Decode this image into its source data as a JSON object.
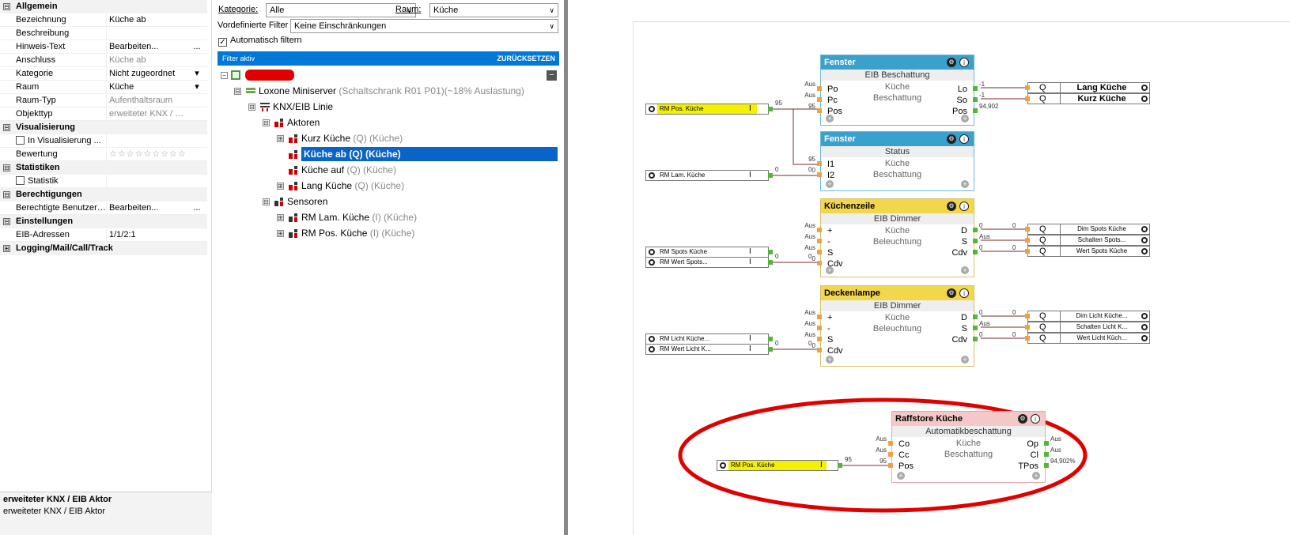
{
  "properties": {
    "rows": [
      {
        "type": "cat",
        "box": "⊟",
        "label": "Allgemein"
      },
      {
        "type": "prop",
        "name": "Bezeichnung",
        "value": "Küche ab"
      },
      {
        "type": "prop",
        "name": "Beschreibung",
        "value": ""
      },
      {
        "type": "prop",
        "name": "Hinweis-Text",
        "value": "Bearbeiten...",
        "button": "..."
      },
      {
        "type": "prop",
        "name": "Anschluss",
        "value": "Küche ab",
        "gray": true
      },
      {
        "type": "prop",
        "name": "Kategorie",
        "value": "Nicht zugeordnet",
        "button": "▾"
      },
      {
        "type": "prop",
        "name": "Raum",
        "value": "Küche",
        "button": "▾"
      },
      {
        "type": "prop",
        "name": "Raum-Typ",
        "value": "Aufenthaltsraum",
        "gray": true
      },
      {
        "type": "prop",
        "name": "Objekttyp",
        "value": "erweiteter KNX / EIB ...",
        "gray": true
      },
      {
        "type": "cat",
        "box": "⊟",
        "label": "Visualisierung"
      },
      {
        "type": "check",
        "name": "In Visualisierung ...",
        "value": ""
      },
      {
        "type": "prop",
        "name": "Bewertung",
        "value": "☆☆☆☆☆☆☆☆☆",
        "stars": true
      },
      {
        "type": "cat",
        "box": "⊟",
        "label": "Statistiken"
      },
      {
        "type": "check",
        "name": "Statistik",
        "value": ""
      },
      {
        "type": "cat",
        "box": "⊟",
        "label": "Berechtigungen"
      },
      {
        "type": "prop",
        "name": "Berechtigte Benutzer ...",
        "value": "Bearbeiten...",
        "button": "..."
      },
      {
        "type": "cat",
        "box": "⊟",
        "label": "Einstellungen"
      },
      {
        "type": "prop",
        "name": "EIB-Adressen",
        "value": "1/1/2:1"
      },
      {
        "type": "cat",
        "box": "⊞",
        "label": "Logging/Mail/Call/Track"
      }
    ],
    "desc_title": "erweiteter KNX / EIB Aktor",
    "desc_text": "erweiteter KNX / EIB Aktor"
  },
  "tree_panel": {
    "kategorie_label": "Kategorie:",
    "kategorie_value": "Alle",
    "raum_label": "Raum:",
    "raum_value": "Küche",
    "vordef_label": "Vordefinierte Filter",
    "vordef_value": "Keine Einschränkungen",
    "auto_filter_label": "Automatisch filtern",
    "filter_status": "Filter aktiv",
    "reset_label": "ZURÜCKSETZEN",
    "collapse_all": "−",
    "nodes": [
      {
        "label": "Loxone Miniserver",
        "suffix": " (Schaltschrank R01 P01)(~18% Auslastung)",
        "icon": "server",
        "level": 1,
        "exp": "⊟"
      },
      {
        "label": "KNX/EIB Linie",
        "suffix": "",
        "icon": "bus",
        "level": 2,
        "exp": "⊟"
      },
      {
        "label": "Aktoren",
        "suffix": "",
        "icon": "actor",
        "level": 3,
        "exp": "⊟"
      },
      {
        "label": "Kurz Küche",
        "suffix": " (Q) (Küche)",
        "icon": "actor",
        "level": 4,
        "exp": "⊞"
      },
      {
        "label": "Küche ab (Q) (Küche)",
        "suffix": "",
        "icon": "actor",
        "level": 4,
        "exp": "",
        "selected": true
      },
      {
        "label": "Küche auf",
        "suffix": " (Q) (Küche)",
        "icon": "actor",
        "level": 4,
        "exp": ""
      },
      {
        "label": "Lang Küche",
        "suffix": " (Q) (Küche)",
        "icon": "actor",
        "level": 4,
        "exp": "⊞"
      },
      {
        "label": "Sensoren",
        "suffix": "",
        "icon": "sensor",
        "level": 3,
        "exp": "⊟"
      },
      {
        "label": "RM Lam. Küche",
        "suffix": " (I) (Küche)",
        "icon": "sensor",
        "level": 4,
        "exp": "⊞"
      },
      {
        "label": "RM Pos. Küche",
        "suffix": " (I) (Küche)",
        "icon": "sensor",
        "level": 4,
        "exp": "⊞"
      }
    ]
  },
  "canvas": {
    "blocks": {
      "fenster1": {
        "title": "Fenster",
        "subtitle": "EIB Beschattung",
        "center1": "Küche",
        "center2": "Beschattung",
        "in": [
          "Po",
          "Pc",
          "Pos"
        ],
        "out": [
          "Lo",
          "So",
          "Pos"
        ],
        "in_tags": [
          "Aus",
          "Aus",
          "95"
        ],
        "out_tags": [
          "-1",
          "-1",
          "94,902"
        ]
      },
      "fenster2": {
        "title": "Fenster",
        "subtitle": "Status",
        "center1": "Küche",
        "center2": "Beschattung",
        "in": [
          "I1",
          "I2"
        ],
        "in_tags": [
          "95",
          "0"
        ]
      },
      "kuechenzeile": {
        "title": "Küchenzeile",
        "subtitle": "EIB Dimmer",
        "center1": "Küche",
        "center2": "Beleuchtung",
        "in": [
          "+",
          "-",
          "S",
          "Cdv"
        ],
        "out": [
          "D",
          "S",
          "Cdv"
        ],
        "in_tags": [
          "Aus",
          "Aus",
          "Aus",
          "0"
        ],
        "out_tags": [
          "0",
          "Aus",
          "0"
        ],
        "out_tags2": [
          "0",
          "",
          "0"
        ]
      },
      "deckenlampe": {
        "title": "Deckenlampe",
        "subtitle": "EIB Dimmer",
        "center1": "Küche",
        "center2": "Beleuchtung",
        "in": [
          "+",
          "-",
          "S",
          "Cdv"
        ],
        "out": [
          "D",
          "S",
          "Cdv"
        ],
        "in_tags": [
          "Aus",
          "Aus",
          "Aus",
          "0"
        ],
        "out_tags": [
          "0",
          "Aus",
          "0"
        ],
        "out_tags2": [
          "0",
          "",
          "0"
        ]
      },
      "raffstore": {
        "title": "Raffstore Küche",
        "subtitle": "Automatikbeschattung",
        "center1": "Küche",
        "center2": "Beschattung",
        "in": [
          "Co",
          "Cc",
          "Pos"
        ],
        "out": [
          "Op",
          "Cl",
          "TPos"
        ],
        "in_tags": [
          "Aus",
          "Aus",
          "95"
        ],
        "out_tags": [
          "Aus",
          "Aus",
          "94,902%"
        ]
      }
    },
    "inputs": {
      "rm_pos_1": {
        "label": "RM Pos. Küche",
        "pipe": "I",
        "value": "95"
      },
      "rm_lam": {
        "label": "RM Lam. Küche",
        "pipe": "I",
        "value": "0",
        "value2": "0"
      },
      "rm_spots": {
        "label": "RM Spots Küche",
        "pipe": "I"
      },
      "rm_wert_spots": {
        "label": "RM Wert Spots...",
        "pipe": "I",
        "value": "0",
        "value2": "0"
      },
      "rm_licht": {
        "label": "RM Licht Küche...",
        "pipe": "I"
      },
      "rm_wert_licht": {
        "label": "RM Wert Licht K...",
        "pipe": "I",
        "value": "0",
        "value2": "0"
      },
      "rm_pos_2": {
        "label": "RM Pos. Küche",
        "pipe": "I",
        "value": "95"
      }
    },
    "outputs": {
      "lang": {
        "q": "Q",
        "label": "Lang Küche"
      },
      "kurz": {
        "q": "Q",
        "label": "Kurz Küche"
      },
      "dim_spots": {
        "q": "Q",
        "label": "Dim Spots Küche"
      },
      "schalten_spots": {
        "q": "Q",
        "label": "Schalten Spots..."
      },
      "wert_spots": {
        "q": "Q",
        "label": "Wert Spots Küche"
      },
      "dim_licht": {
        "q": "Q",
        "label": "Dim Licht Küche..."
      },
      "schalten_licht": {
        "q": "Q",
        "label": "Schalten Licht K..."
      },
      "wert_licht": {
        "q": "Q",
        "label": "Wert Licht Küch..."
      }
    },
    "colors": {
      "blue_header": "#3aa0cc",
      "yellow_header": "#f2d64b",
      "pink_header": "#f4c7c9",
      "annotation": "#e00000",
      "wire": "#7a2a2a"
    }
  }
}
